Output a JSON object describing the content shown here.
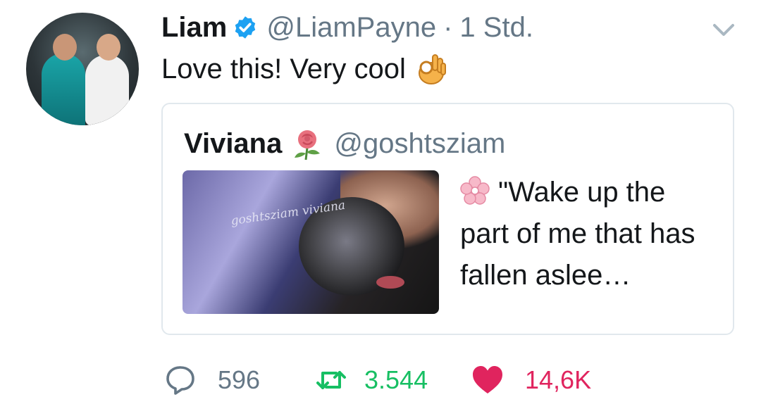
{
  "tweet": {
    "author_name": "Liam",
    "author_handle": "@LiamPayne",
    "separator": "·",
    "time": "1 Std.",
    "text": "Love this! Very cool",
    "avatar_icon": "profile-photo",
    "verified_icon": "verified-badge-icon",
    "emoji_icon": "ok-hand-icon"
  },
  "quoted": {
    "author_name": "Viviana",
    "author_handle": "@goshtsziam",
    "name_emoji_icon": "rose-icon",
    "text_emoji_icon": "cherry-blossom-icon",
    "text": "\"Wake up the part of me that has fallen aslee…",
    "thumbnail_watermark": "goshtsziam viviana"
  },
  "actions": {
    "reply_count": "596",
    "retweet_count": "3.544",
    "like_count": "14,6K"
  },
  "colors": {
    "secondary_text": "#657786",
    "verified": "#1da1f2",
    "retweet": "#17bf63",
    "like": "#e0245e",
    "border": "#e1e8ed"
  }
}
